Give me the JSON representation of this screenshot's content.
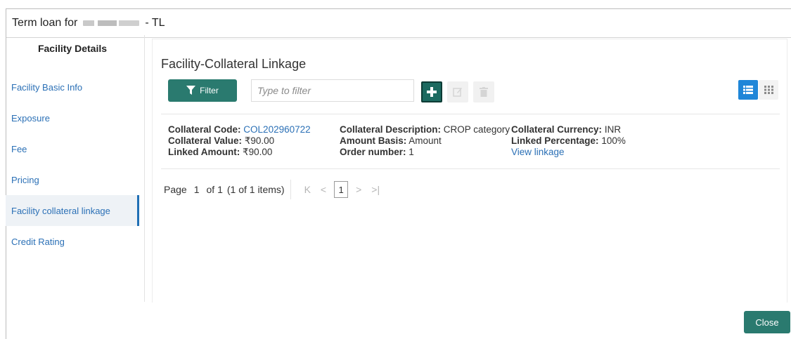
{
  "window": {
    "title_prefix": "Term loan for",
    "title_suffix": "- TL"
  },
  "sidebar": {
    "heading": "Facility Details",
    "items": [
      {
        "label": "Facility Basic Info"
      },
      {
        "label": "Exposure"
      },
      {
        "label": "Fee"
      },
      {
        "label": "Pricing"
      },
      {
        "label": "Facility collateral linkage",
        "active": true
      },
      {
        "label": "Credit Rating"
      }
    ]
  },
  "main": {
    "title": "Facility-Collateral Linkage",
    "filter_label": "Filter",
    "filter_placeholder": "Type to filter",
    "record": {
      "code_label": "Collateral Code:",
      "code_value": "COL202960722",
      "value_label": "Collateral Value:",
      "value_value": "₹90.00",
      "linked_amount_label": "Linked Amount:",
      "linked_amount_value": "₹90.00",
      "description_label": "Collateral Description:",
      "description_value": "CROP category",
      "amount_basis_label": "Amount Basis:",
      "amount_basis_value": "Amount",
      "order_label": "Order number:",
      "order_value": "1",
      "currency_label": "Collateral Currency:",
      "currency_value": "INR",
      "linked_pct_label": "Linked Percentage:",
      "linked_pct_value": "100%",
      "view_linkage": "View linkage"
    },
    "pager": {
      "page_label": "Page",
      "page_value": "1",
      "of_label": "of 1",
      "items_label": "(1 of 1 items)",
      "current": "1"
    }
  },
  "footer": {
    "close_label": "Close"
  },
  "colors": {
    "primary_button": "#2a7a6f",
    "link": "#2b70b6",
    "active_view": "#1f86d8"
  }
}
